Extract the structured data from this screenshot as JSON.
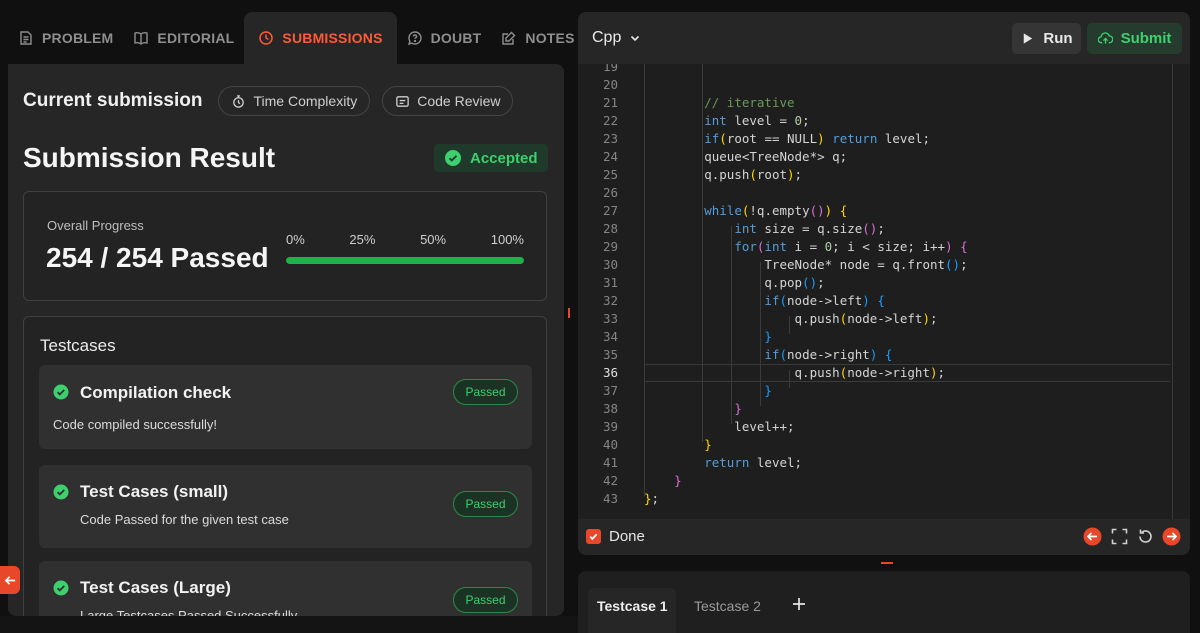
{
  "tabs": [
    {
      "label": "PROBLEM"
    },
    {
      "label": "EDITORIAL"
    },
    {
      "label": "SUBMISSIONS"
    },
    {
      "label": "DOUBT"
    },
    {
      "label": "NOTES"
    }
  ],
  "current": {
    "title": "Current submission",
    "time_complexity": "Time Complexity",
    "code_review": "Code Review"
  },
  "result": {
    "title": "Submission Result",
    "status": "Accepted",
    "progress_label": "Overall Progress",
    "progress_value": "254 / 254 Passed",
    "progress_fraction": 1.0,
    "ticks": [
      "0%",
      "25%",
      "50%",
      "100%"
    ]
  },
  "testcases": {
    "title": "Testcases",
    "items": [
      {
        "name": "Compilation check",
        "desc": "Code compiled successfully!",
        "badge": "Passed"
      },
      {
        "name": "Test Cases (small)",
        "desc": "Code Passed for the given test case",
        "badge": "Passed"
      },
      {
        "name": "Test Cases (Large)",
        "desc": "Large Testcases Passed Successfully",
        "badge": "Passed"
      }
    ]
  },
  "editor": {
    "language": "Cpp",
    "run_label": "Run",
    "submit_label": "Submit",
    "done_label": "Done",
    "line_numbers": [
      "19",
      "20",
      "21",
      "22",
      "23",
      "24",
      "25",
      "26",
      "27",
      "28",
      "29",
      "30",
      "31",
      "32",
      "33",
      "34",
      "35",
      "36",
      "37",
      "38",
      "39",
      "40",
      "41",
      "42",
      "43"
    ],
    "current_line": "36"
  },
  "bottom_tabs": [
    {
      "label": "Testcase 1"
    },
    {
      "label": "Testcase 2"
    }
  ],
  "colors": {
    "accent": "#ff5a36",
    "success": "#3ecf6e",
    "progress": "#22b04b"
  }
}
